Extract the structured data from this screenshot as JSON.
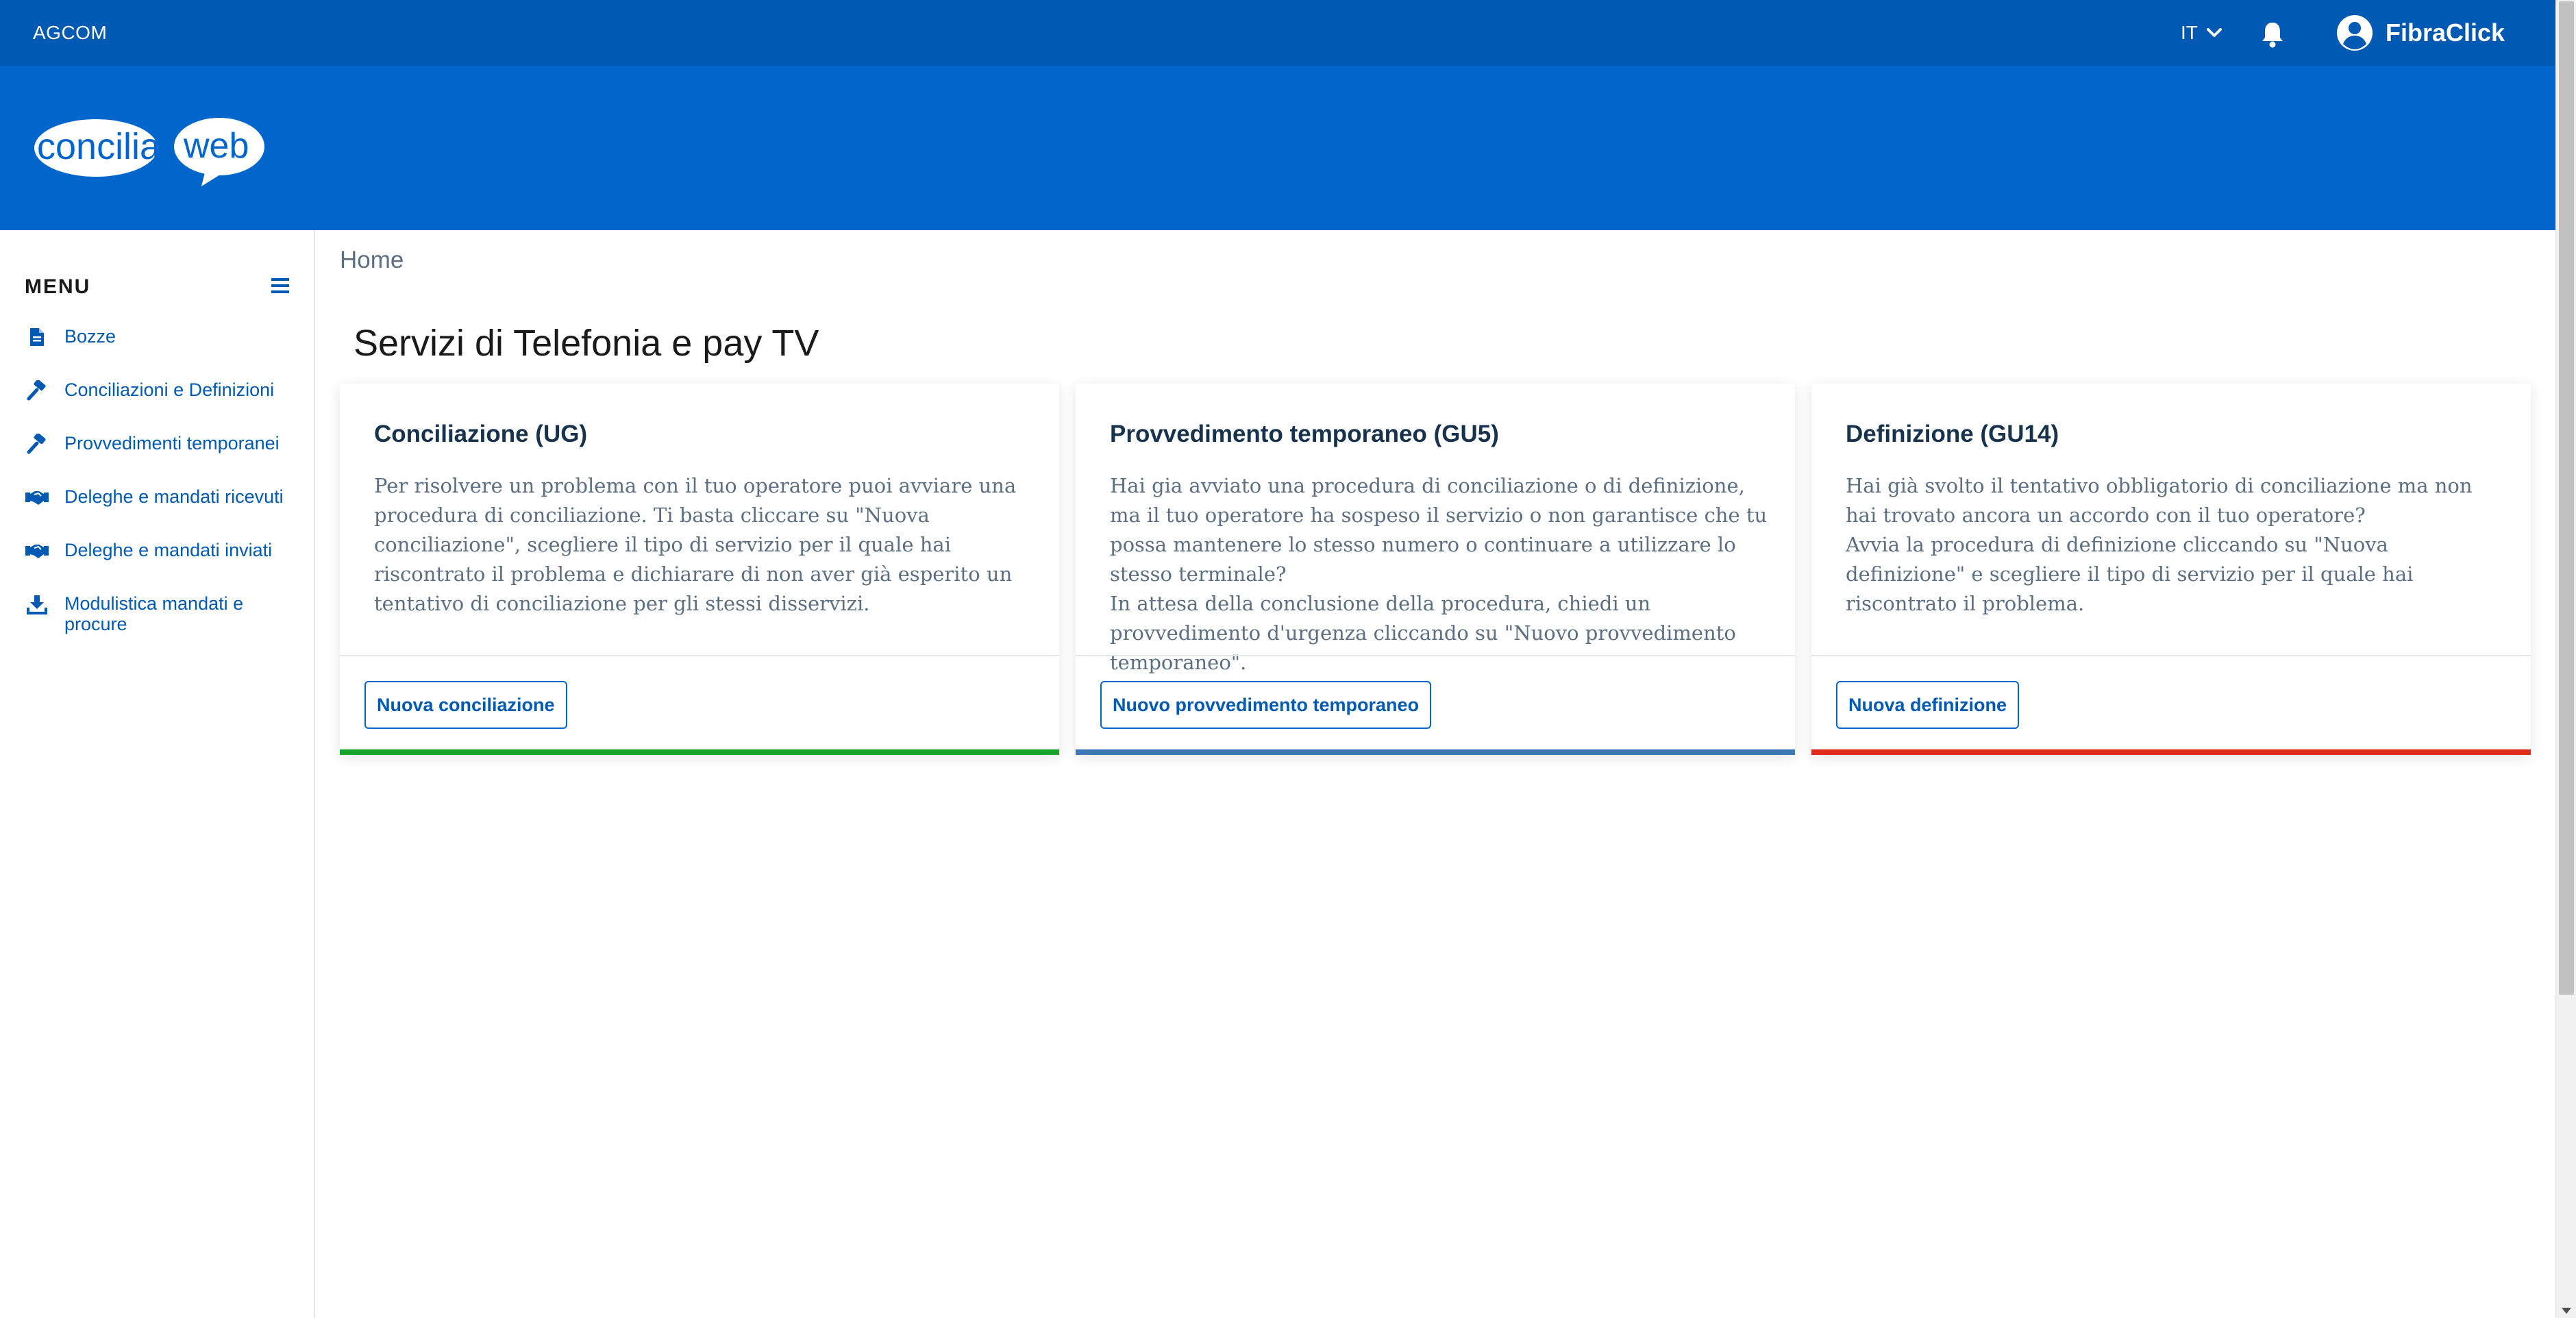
{
  "topbar": {
    "org": "AGCOM",
    "language": "IT",
    "user_name": "FibraClick",
    "icons": [
      "chevron-down-icon",
      "bell-icon",
      "user-circle-icon"
    ]
  },
  "header": {
    "logo_text_part1": "concilia",
    "logo_text_part2": "web"
  },
  "sidebar": {
    "title": "MENU",
    "items": [
      {
        "label": "Bozze",
        "icon": "file-icon"
      },
      {
        "label": "Conciliazioni e Definizioni",
        "icon": "gavel-icon"
      },
      {
        "label": "Provvedimenti temporanei",
        "icon": "gavel-icon"
      },
      {
        "label": "Deleghe e mandati ricevuti",
        "icon": "handshake-icon"
      },
      {
        "label": "Deleghe e mandati inviati",
        "icon": "handshake-icon"
      },
      {
        "label": "Modulistica mandati e procure",
        "icon": "download-icon"
      }
    ]
  },
  "main": {
    "breadcrumb": "Home",
    "title": "Servizi di Telefonia e pay TV",
    "cards": [
      {
        "title": "Conciliazione (UG)",
        "paragraphs": [
          "Per risolvere un problema con il tuo operatore puoi avviare una procedura di conciliazione. Ti basta cliccare su \"Nuova conciliazione\", scegliere il tipo di servizio per il quale hai riscontrato il problema e dichiarare di non aver già esperito un tentativo di conciliazione per gli stessi disservizi."
        ],
        "button": "Nuova conciliazione",
        "accent": "#1aa32c"
      },
      {
        "title": "Provvedimento temporaneo (GU5)",
        "paragraphs": [
          "Hai gia avviato una procedura di conciliazione o di definizione, ma il tuo operatore ha sospeso il servizio o non garantisce che tu possa mantenere lo stesso numero o continuare a utilizzare lo stesso terminale?",
          "In attesa della conclusione della procedura, chiedi un provvedimento d'urgenza cliccando su \"Nuovo provvedimento temporaneo\"."
        ],
        "button": "Nuovo provvedimento temporaneo",
        "accent": "#3d77b6"
      },
      {
        "title": "Definizione (GU14)",
        "paragraphs": [
          "Hai già svolto il tentativo obbligatorio di conciliazione ma non hai trovato ancora un accordo con il tuo operatore?",
          "Avvia la procedura di definizione cliccando su \"Nuova definizione\" e scegliere il tipo di servizio per il quale hai riscontrato il problema."
        ],
        "button": "Nuova definizione",
        "accent": "#e02a1d"
      }
    ]
  },
  "colors": {
    "topbar": "#0059b3",
    "header": "#0066cc",
    "link": "#0059b3"
  }
}
